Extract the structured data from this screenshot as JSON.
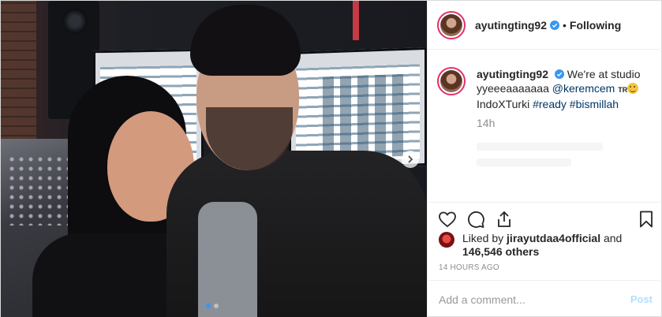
{
  "header": {
    "username": "ayutingting92",
    "separator": "•",
    "follow_label": "Following"
  },
  "caption": {
    "username": "ayutingting92",
    "text_before_mention": "We're at studio yyeeeaaaaaaa ",
    "mention": "@keremcem",
    "flag": "TR",
    "text_after": "IndoXTurki ",
    "tag1": "#ready",
    "tag2": "#bismillah",
    "time": "14h"
  },
  "likes": {
    "prefix": "Liked by ",
    "user": "jirayutdaa4official",
    "conj": " and",
    "count": "146,546 others"
  },
  "timestamp": "14 HOURS AGO",
  "add_comment": {
    "placeholder": "Add a comment...",
    "post_label": "Post"
  },
  "carousel": {
    "slides": 2,
    "active": 1
  },
  "icons": {
    "verified": "verified-badge-icon",
    "like": "heart-icon",
    "comment": "comment-bubble-icon",
    "share": "share-icon",
    "save": "bookmark-icon",
    "next": "chevron-right-icon"
  },
  "colors": {
    "link": "#003569",
    "verified": "#3897f0",
    "muted": "#8e8e8e",
    "post_disabled": "#b2dffc",
    "story_ring": "#e1306c"
  }
}
